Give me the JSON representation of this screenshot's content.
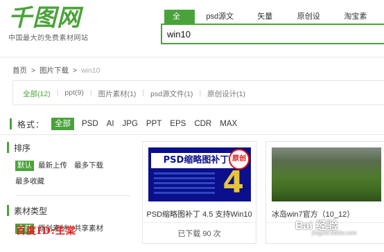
{
  "header": {
    "logo_text": "千图网",
    "slogan": "中国最大的免费素材网站",
    "search_tabs": [
      "全部",
      "psd源文件",
      "矢量图",
      "原创设计",
      "淘宝素材"
    ],
    "search_value": "win10",
    "accent_color": "#4aa33a"
  },
  "breadcrumb": {
    "home": "首页",
    "sep1": ">",
    "section": "图片下载",
    "sep2": ">",
    "current": "win10"
  },
  "filters": [
    {
      "label": "全部(12)"
    },
    {
      "label": "ppt(9)"
    },
    {
      "label": "图片素材(1)"
    },
    {
      "label": "psd源文件(1)"
    },
    {
      "label": "原创设计(1)"
    }
  ],
  "format": {
    "label": "格式：",
    "options": [
      "全部",
      "PSD",
      "AI",
      "JPG",
      "PPT",
      "EPS",
      "CDR",
      "MAX"
    ]
  },
  "sidebar": {
    "sort_title": "排序",
    "sort_options": [
      "默认",
      "最新上传",
      "最多下载",
      "最多收藏"
    ],
    "type_title": "素材类型",
    "type_options": [
      "全部",
      "原创素材",
      "共享素材"
    ]
  },
  "cards": [
    {
      "banner": "PSD缩略图补丁",
      "badge": "原创",
      "big_number": "4",
      "title": "PSD缩略图补丁 4.5 支持Win10",
      "footer": "已下载 90 次"
    },
    {
      "title": "冰岛win7官方（10_12）",
      "footer": ""
    }
  ],
  "watermark": {
    "text": "百度ID:生棠",
    "baidu": "Bai 经验",
    "baidu_url": "jingyan.baidu.com"
  }
}
